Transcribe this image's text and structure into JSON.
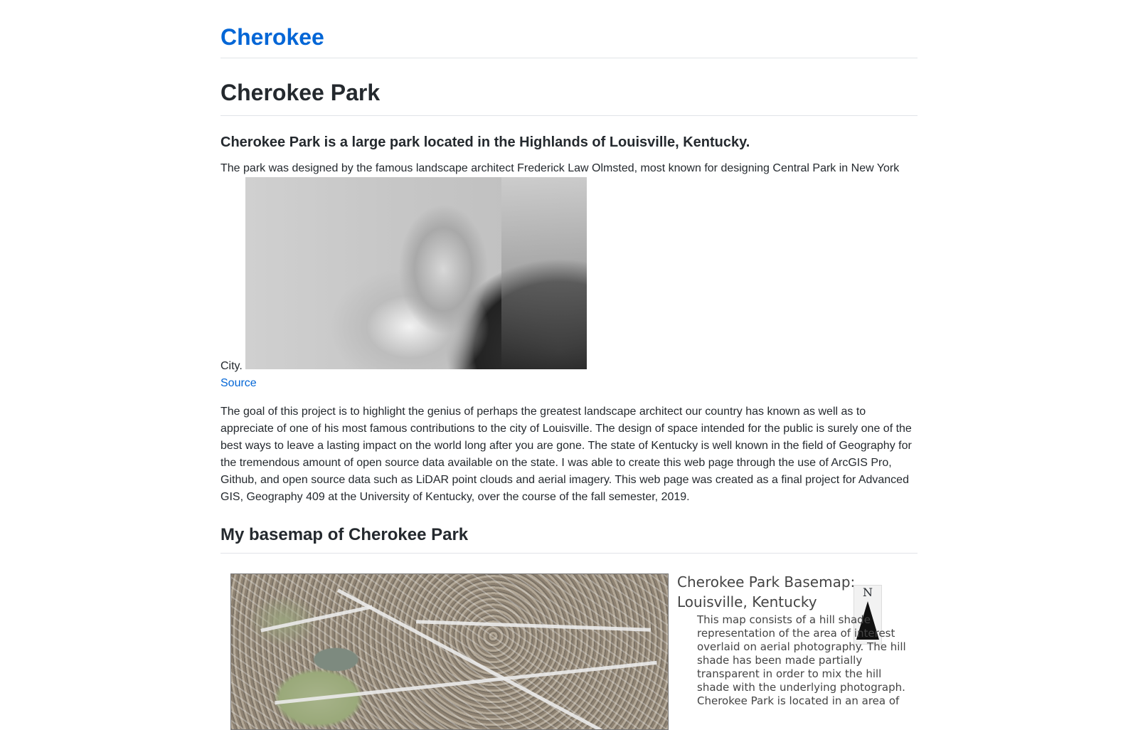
{
  "site": {
    "title": "Cherokee"
  },
  "page": {
    "title": "Cherokee Park",
    "lead": "Cherokee Park is a large park located in the Highlands of Louisville, Kentucky.",
    "intro": "The park was designed by the famous landscape architect Frederick Law Olmsted, most known for designing Central Park in New York City.",
    "source_label": "Source",
    "goal": "The goal of this project is to highlight the genius of perhaps the greatest landscape architect our country has known as well as to appreciate of one of his most famous contributions to the city of Louisville. The design of space intended for the public is surely one of the best ways to leave a lasting impact on the world long after you are gone. The state of Kentucky is well known in the field of Geography for the tremendous amount of open source data available on the state. I was able to create this web page through the use of ArcGIS Pro, Github, and open source data such as LiDAR point clouds and aerial imagery. This web page was created as a final project for Advanced GIS, Geography 409 at the University of Kentucky, over the course of the fall semester, 2019.",
    "basemap_heading": "My basemap of Cherokee Park"
  },
  "map": {
    "title": "Cherokee Park Basemap: Louisville, Kentucky",
    "north_label": "N",
    "description": "This map consists of a hill shade representation of the area of interest overlaid on aerial photography. The hill shade has been made partially transparent in order to mix the hill shade with the underlying photograph. Cherokee Park is located in an area of"
  },
  "colors": {
    "link": "#0366d6",
    "text": "#24292e",
    "rule": "#e1e4e8"
  },
  "icons": {
    "portrait": "portrait-photo",
    "map": "aerial-map-image",
    "north": "north-arrow-icon"
  }
}
